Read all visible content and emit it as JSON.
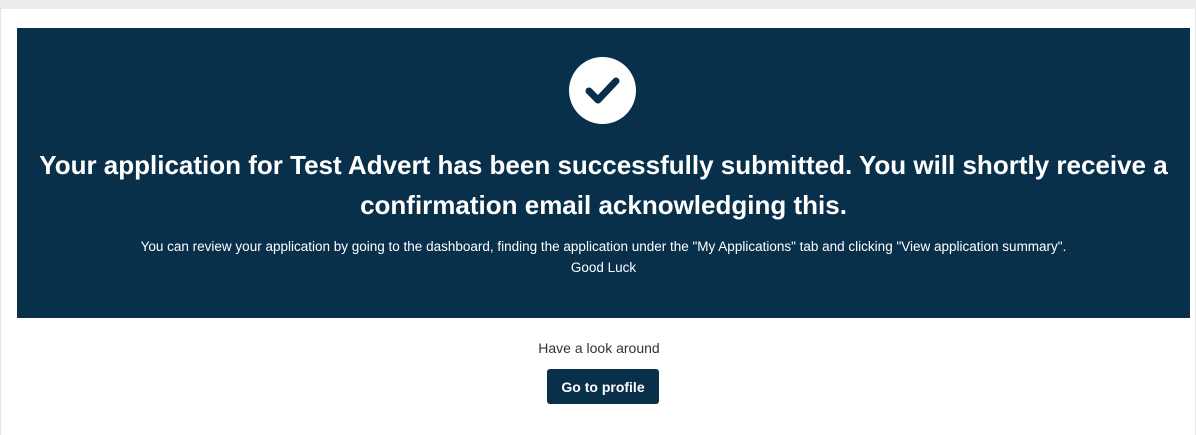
{
  "confirmation": {
    "icon": "checkmark-circle-icon",
    "headline": "Your application for Test Advert has been successfully submitted. You will shortly receive a confirmation email acknowledging this.",
    "instructions": "You can review your application by going to the dashboard, finding the application under the \"My Applications\" tab and clicking \"View application summary\".",
    "sign_off": "Good Luck"
  },
  "footer": {
    "prompt": "Have a look around",
    "profile_button_label": "Go to profile"
  },
  "colors": {
    "banner_background": "#08304b",
    "button_background": "#08304b",
    "page_background": "#ffffff"
  }
}
